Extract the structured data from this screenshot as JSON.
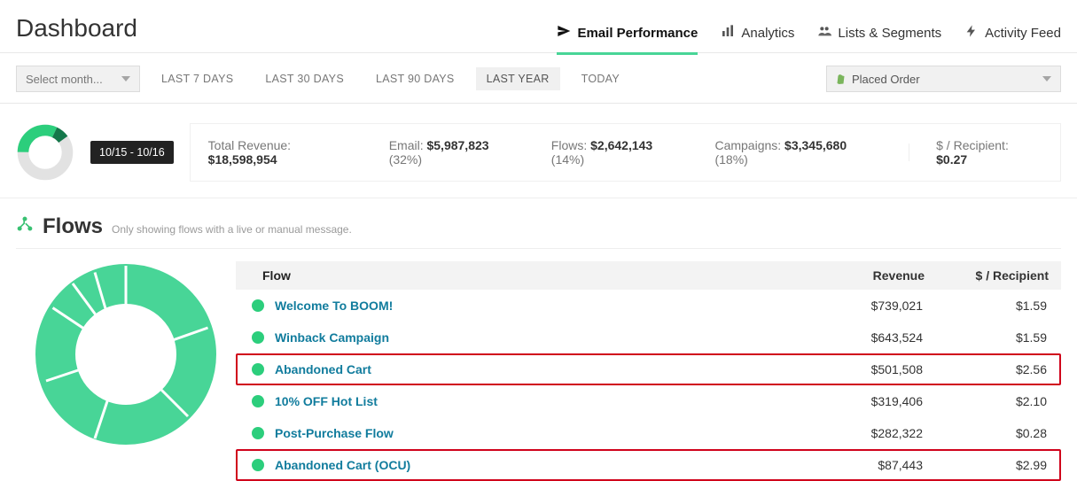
{
  "header": {
    "title": "Dashboard",
    "nav": {
      "email_perf": "Email Performance",
      "analytics": "Analytics",
      "lists_segments": "Lists & Segments",
      "activity_feed": "Activity Feed"
    }
  },
  "filters": {
    "month_placeholder": "Select month...",
    "ranges": {
      "r7": "LAST 7 DAYS",
      "r30": "LAST 30 DAYS",
      "r90": "LAST 90 DAYS",
      "rlast": "LAST YEAR",
      "rtoday": "TODAY"
    },
    "event_select": "Placed Order"
  },
  "summary": {
    "date_range": "10/15 - 10/16",
    "total_label": "Total Revenue: ",
    "total_value": "$18,598,954",
    "email_label": "Email: ",
    "email_value": "$5,987,823",
    "email_pct": " (32%)",
    "flows_label": "Flows: ",
    "flows_value": "$2,642,143",
    "flows_pct": " (14%)",
    "campaigns_label": "Campaigns: ",
    "campaigns_value": "$3,345,680",
    "campaigns_pct": " (18%)",
    "per_recipient_label": "$ / Recipient: ",
    "per_recipient_value": "$0.27"
  },
  "flows": {
    "heading": "Flows",
    "hint": "Only showing flows with a live or manual message.",
    "columns": {
      "flow": "Flow",
      "revenue": "Revenue",
      "per_recipient": "$ / Recipient"
    },
    "rows": [
      {
        "name": "Welcome To BOOM!",
        "revenue": "$739,021",
        "per_recipient": "$1.59",
        "highlight": false
      },
      {
        "name": "Winback Campaign",
        "revenue": "$643,524",
        "per_recipient": "$1.59",
        "highlight": false
      },
      {
        "name": "Abandoned Cart",
        "revenue": "$501,508",
        "per_recipient": "$2.56",
        "highlight": true
      },
      {
        "name": "10% OFF Hot List",
        "revenue": "$319,406",
        "per_recipient": "$2.10",
        "highlight": false
      },
      {
        "name": "Post-Purchase Flow",
        "revenue": "$282,322",
        "per_recipient": "$0.28",
        "highlight": false
      },
      {
        "name": "Abandoned Cart (OCU)",
        "revenue": "$87,443",
        "per_recipient": "$2.99",
        "highlight": true
      }
    ]
  },
  "chart_data": [
    {
      "type": "pie",
      "title": "Revenue breakdown",
      "series": [
        {
          "name": "Email",
          "value": 32,
          "color": "#2cce7c"
        },
        {
          "name": "Other",
          "value": 68,
          "color": "#e2e2e2"
        }
      ]
    },
    {
      "type": "pie",
      "title": "Flows revenue share",
      "series": [
        {
          "name": "Welcome To BOOM!",
          "value": 739021
        },
        {
          "name": "Winback Campaign",
          "value": 643524
        },
        {
          "name": "Abandoned Cart",
          "value": 501508
        },
        {
          "name": "10% OFF Hot List",
          "value": 319406
        },
        {
          "name": "Post-Purchase Flow",
          "value": 282322
        },
        {
          "name": "Abandoned Cart (OCU)",
          "value": 87443
        }
      ],
      "color": "#48d597"
    }
  ]
}
